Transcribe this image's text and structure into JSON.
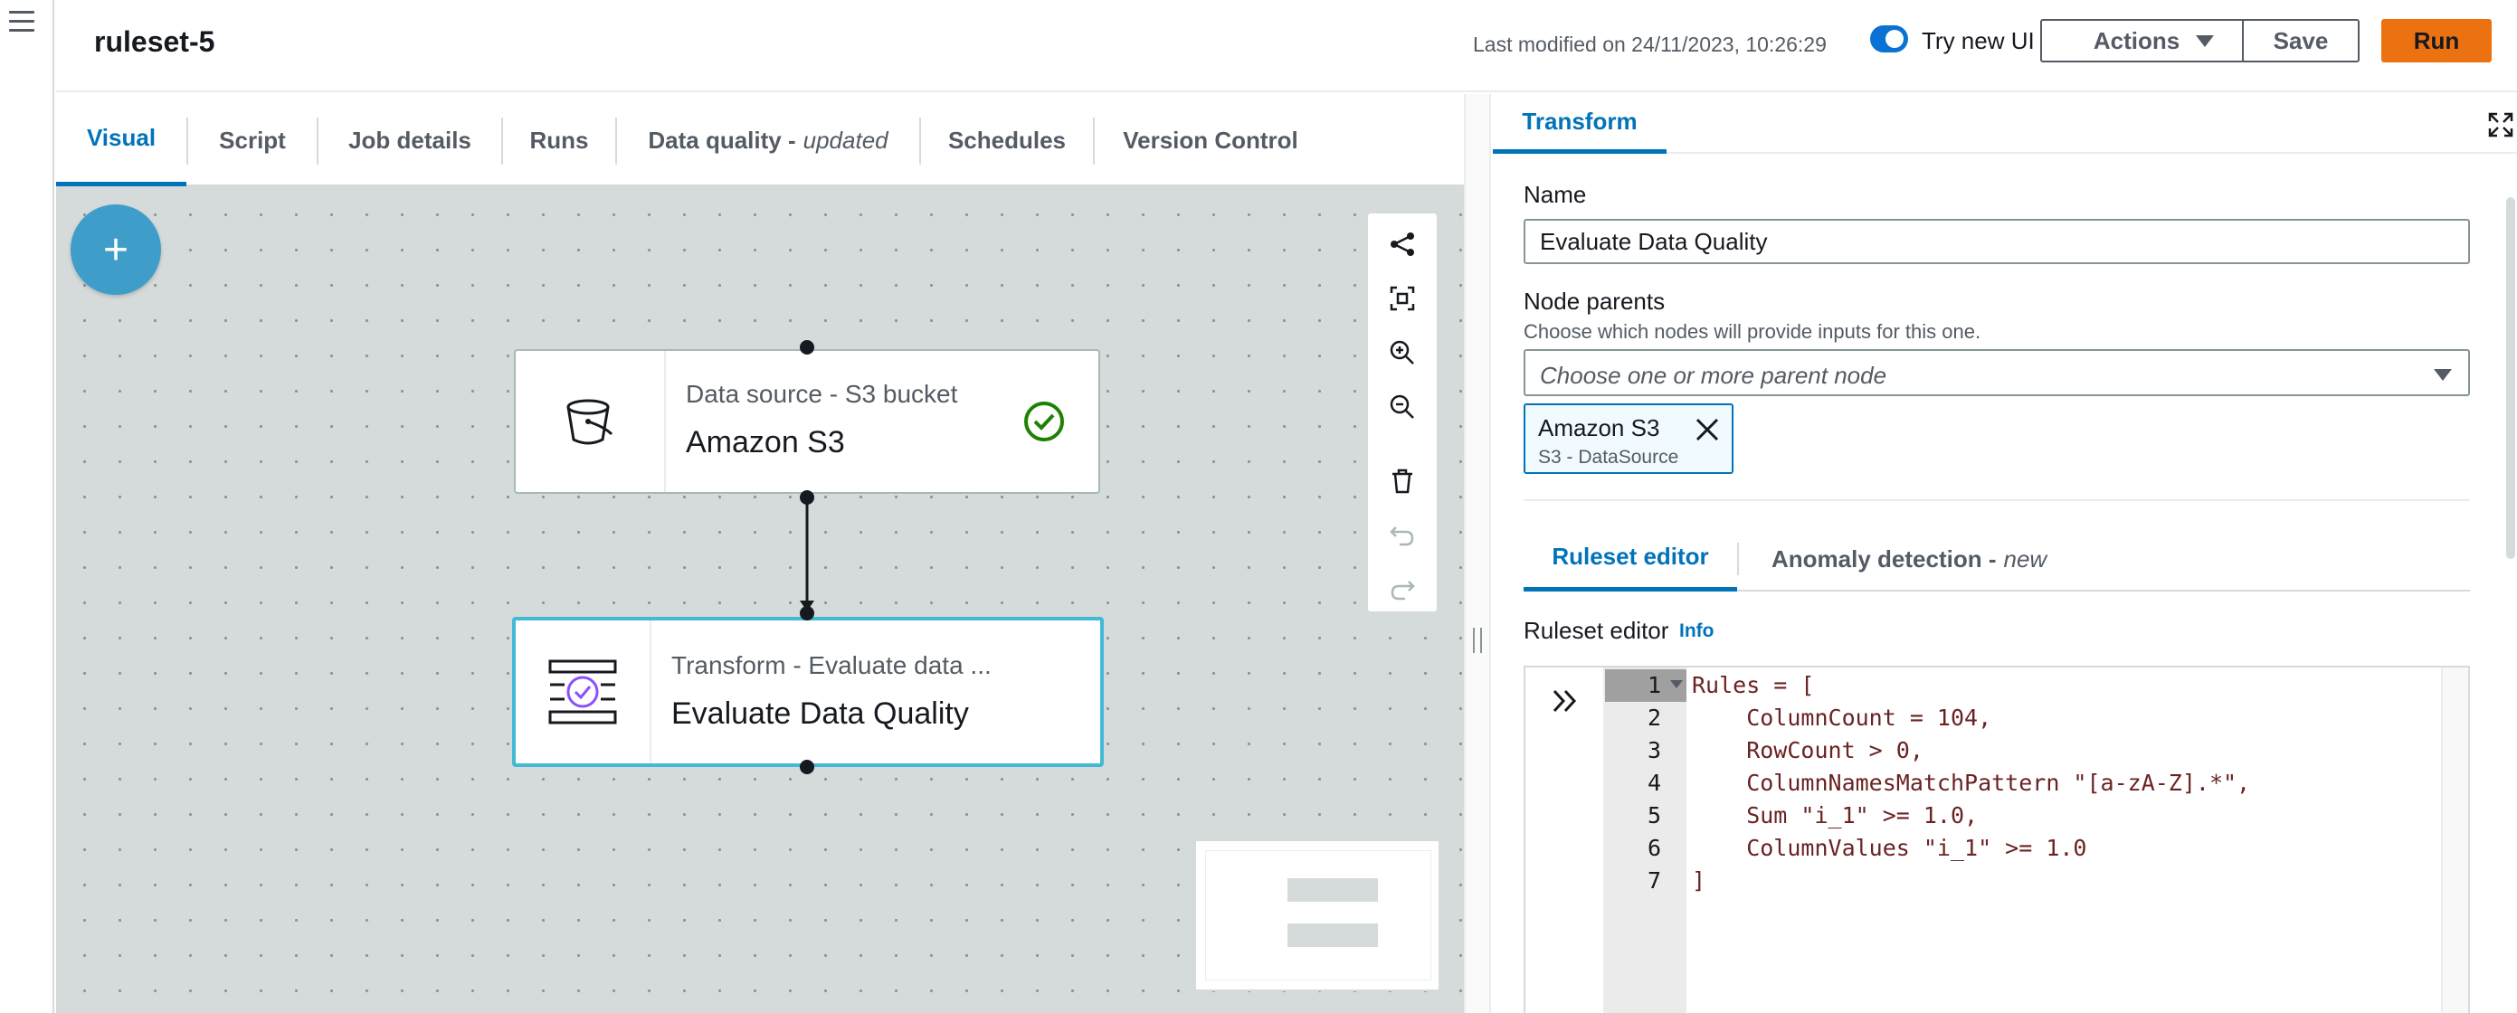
{
  "header": {
    "job_name": "ruleset-5",
    "last_modified": "Last modified on 24/11/2023, 10:26:29",
    "try_new_ui_label": "Try new UI",
    "actions_label": "Actions",
    "save_label": "Save",
    "run_label": "Run"
  },
  "tabs": {
    "visual": "Visual",
    "script": "Script",
    "job_details": "Job details",
    "runs": "Runs",
    "data_quality": "Data quality -",
    "data_quality_suffix": "updated",
    "schedules": "Schedules",
    "version_control": "Version Control"
  },
  "canvas": {
    "add_label": "+",
    "nodes": [
      {
        "type": "Data source - S3 bucket",
        "name": "Amazon S3"
      },
      {
        "type": "Transform - Evaluate data ...",
        "name": "Evaluate Data Quality"
      }
    ]
  },
  "panel": {
    "tab_label": "Transform",
    "name_label": "Name",
    "name_value": "Evaluate Data Quality",
    "node_parents_label": "Node parents",
    "node_parents_desc": "Choose which nodes will provide inputs for this one.",
    "node_parents_placeholder": "Choose one or more parent node",
    "token_title": "Amazon S3",
    "token_subtitle": "S3 - DataSource",
    "ruleset_tab": "Ruleset editor",
    "anomaly_tab": "Anomaly detection -",
    "anomaly_suffix": "new",
    "ruleset_label": "Ruleset editor",
    "info_label": "Info",
    "code_lines": [
      "Rules = [",
      "    ColumnCount = 104,",
      "    RowCount > 0,",
      "    ColumnNamesMatchPattern \"[a-zA-Z].*\",",
      "    Sum \"i_1\" >= 1.0,",
      "    ColumnValues \"i_1\" >= 1.0",
      "]"
    ],
    "line_numbers": [
      "1",
      "2",
      "3",
      "4",
      "5",
      "6",
      "7"
    ]
  },
  "colors": {
    "accent": "#0073bb",
    "run": "#ec7211",
    "success": "#1d8102",
    "selected_border": "#44b9d6"
  },
  "icons": [
    "menu-icon",
    "caret-down-icon",
    "bucket-icon",
    "check-circle-icon",
    "data-quality-icon",
    "layout-icon",
    "fit-view-icon",
    "zoom-in-icon",
    "zoom-out-icon",
    "trash-icon",
    "undo-icon",
    "redo-icon",
    "expand-icon",
    "close-icon",
    "chevron-double-right-icon"
  ]
}
